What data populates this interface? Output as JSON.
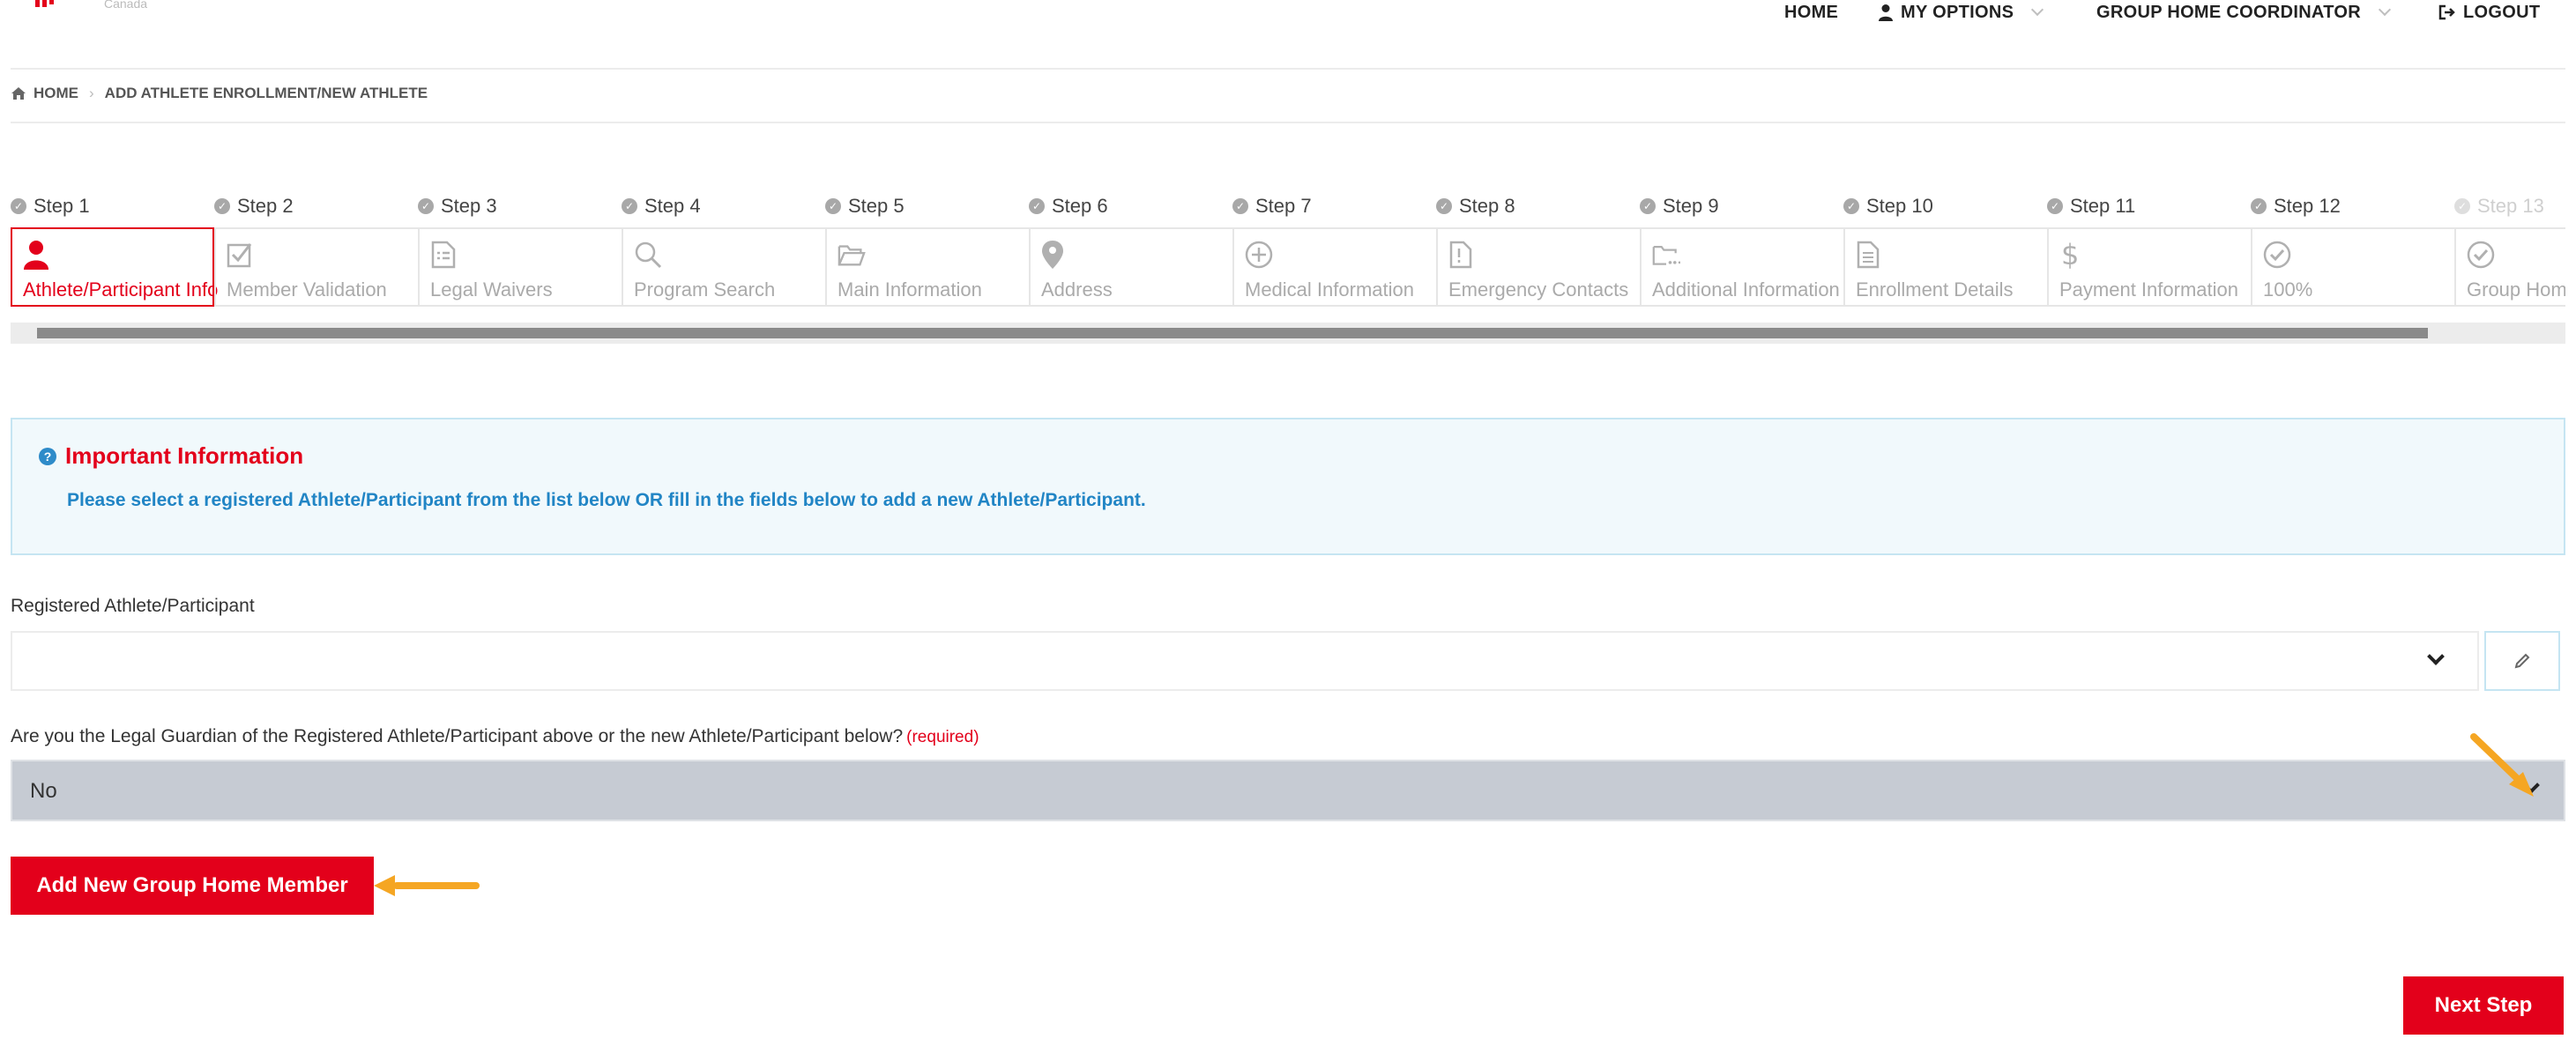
{
  "colors": {
    "accent": "#e3001b",
    "info_text": "#2185c5",
    "arrow": "#f5a623"
  },
  "logo": {
    "text": "Canada"
  },
  "nav": {
    "home": "HOME",
    "my_options": "MY OPTIONS",
    "coordinator": "GROUP HOME COORDINATOR",
    "logout": "LOGOUT"
  },
  "breadcrumb": {
    "home": "HOME",
    "current": "ADD ATHLETE ENROLLMENT/NEW ATHLETE"
  },
  "steps": [
    {
      "step": "Step 1",
      "label": "Athlete/Participant Info",
      "icon": "person-icon",
      "state": "active"
    },
    {
      "step": "Step 2",
      "label": "Member Validation",
      "icon": "checkbox-icon",
      "state": "normal"
    },
    {
      "step": "Step 3",
      "label": "Legal Waivers",
      "icon": "document-list-icon",
      "state": "normal"
    },
    {
      "step": "Step 4",
      "label": "Program Search",
      "icon": "search-icon",
      "state": "normal"
    },
    {
      "step": "Step 5",
      "label": "Main Information",
      "icon": "folder-icon",
      "state": "normal"
    },
    {
      "step": "Step 6",
      "label": "Address",
      "icon": "map-pin-icon",
      "state": "normal"
    },
    {
      "step": "Step 7",
      "label": "Medical Information",
      "icon": "plus-circle-icon",
      "state": "normal"
    },
    {
      "step": "Step 8",
      "label": "Emergency Contacts",
      "icon": "alert-document-icon",
      "state": "normal"
    },
    {
      "step": "Step 9",
      "label": "Additional Information",
      "icon": "folder-dots-icon",
      "state": "normal"
    },
    {
      "step": "Step 10",
      "label": "Enrollment Details",
      "icon": "document-icon",
      "state": "normal"
    },
    {
      "step": "Step 11",
      "label": "Payment Information",
      "icon": "dollar-icon",
      "state": "normal"
    },
    {
      "step": "Step 12",
      "label": "100%",
      "icon": "check-circle-icon",
      "state": "normal"
    },
    {
      "step": "Step 13",
      "label": "Group Home",
      "icon": "check-circle-icon",
      "state": "faded"
    }
  ],
  "info": {
    "title": "Important Information",
    "text": "Please select a registered Athlete/Participant from the list below OR fill in the fields below to add a new Athlete/Participant."
  },
  "form": {
    "registered_label": "Registered Athlete/Participant",
    "registered_value": "",
    "guardian_label": "Are you the Legal Guardian of the Registered Athlete/Participant above or the new Athlete/Participant below?",
    "guardian_required": "(required)",
    "guardian_value": "No"
  },
  "buttons": {
    "add_member": "Add New Group Home Member",
    "next_step": "Next Step"
  }
}
